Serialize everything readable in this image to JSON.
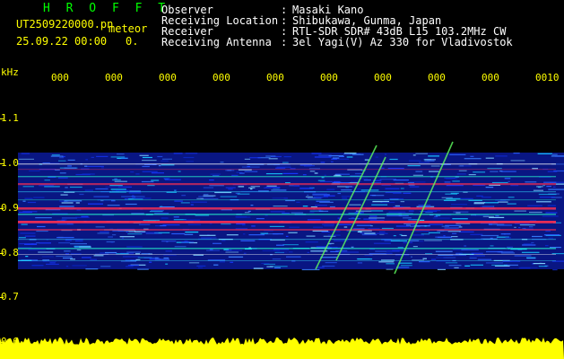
{
  "header": {
    "brand": "H R O F F T",
    "file_name": "UT2509220000.pn",
    "file_suffix": "meteor",
    "date_time": "25.09.22 00:00",
    "count": "0."
  },
  "station": {
    "observer_label": "Observer",
    "observer_value": "Masaki Kano",
    "location_label": "Receiving Location",
    "location_value": "Shibukawa, Gunma, Japan",
    "receiver_label": "Receiver",
    "receiver_value": "RTL-SDR SDR# 43dB L15 103.2MHz CW",
    "antenna_label": "Receiving Antenna",
    "antenna_value": "3el Yagi(V) Az 330 for Vladivostok",
    "separator": ":"
  },
  "axis": {
    "unit": "kHz",
    "y_ticks": [
      "1.1",
      "1.0",
      "0.9",
      "0.8",
      "0.7",
      "0.6"
    ],
    "x_ticks": [
      "000",
      "000",
      "000",
      "000",
      "000",
      "000",
      "000",
      "000",
      "000",
      "0010"
    ]
  },
  "colors": {
    "background": "#000000",
    "annotation": "#ffff00",
    "brand": "#00ff00",
    "info_text": "#ffffff",
    "noise_floor": "#0a1a9a",
    "band_peak": "#ff3050",
    "meteor_trail": "#60ff60",
    "power_bar": "#ffff00"
  }
}
